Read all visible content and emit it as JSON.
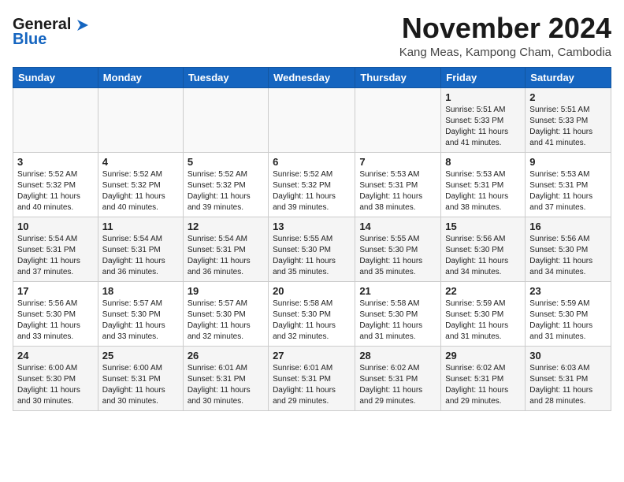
{
  "header": {
    "logo_general": "General",
    "logo_blue": "Blue",
    "month": "November 2024",
    "location": "Kang Meas, Kampong Cham, Cambodia"
  },
  "weekdays": [
    "Sunday",
    "Monday",
    "Tuesday",
    "Wednesday",
    "Thursday",
    "Friday",
    "Saturday"
  ],
  "weeks": [
    [
      {
        "day": "",
        "info": ""
      },
      {
        "day": "",
        "info": ""
      },
      {
        "day": "",
        "info": ""
      },
      {
        "day": "",
        "info": ""
      },
      {
        "day": "",
        "info": ""
      },
      {
        "day": "1",
        "info": "Sunrise: 5:51 AM\nSunset: 5:33 PM\nDaylight: 11 hours\nand 41 minutes."
      },
      {
        "day": "2",
        "info": "Sunrise: 5:51 AM\nSunset: 5:33 PM\nDaylight: 11 hours\nand 41 minutes."
      }
    ],
    [
      {
        "day": "3",
        "info": "Sunrise: 5:52 AM\nSunset: 5:32 PM\nDaylight: 11 hours\nand 40 minutes."
      },
      {
        "day": "4",
        "info": "Sunrise: 5:52 AM\nSunset: 5:32 PM\nDaylight: 11 hours\nand 40 minutes."
      },
      {
        "day": "5",
        "info": "Sunrise: 5:52 AM\nSunset: 5:32 PM\nDaylight: 11 hours\nand 39 minutes."
      },
      {
        "day": "6",
        "info": "Sunrise: 5:52 AM\nSunset: 5:32 PM\nDaylight: 11 hours\nand 39 minutes."
      },
      {
        "day": "7",
        "info": "Sunrise: 5:53 AM\nSunset: 5:31 PM\nDaylight: 11 hours\nand 38 minutes."
      },
      {
        "day": "8",
        "info": "Sunrise: 5:53 AM\nSunset: 5:31 PM\nDaylight: 11 hours\nand 38 minutes."
      },
      {
        "day": "9",
        "info": "Sunrise: 5:53 AM\nSunset: 5:31 PM\nDaylight: 11 hours\nand 37 minutes."
      }
    ],
    [
      {
        "day": "10",
        "info": "Sunrise: 5:54 AM\nSunset: 5:31 PM\nDaylight: 11 hours\nand 37 minutes."
      },
      {
        "day": "11",
        "info": "Sunrise: 5:54 AM\nSunset: 5:31 PM\nDaylight: 11 hours\nand 36 minutes."
      },
      {
        "day": "12",
        "info": "Sunrise: 5:54 AM\nSunset: 5:31 PM\nDaylight: 11 hours\nand 36 minutes."
      },
      {
        "day": "13",
        "info": "Sunrise: 5:55 AM\nSunset: 5:30 PM\nDaylight: 11 hours\nand 35 minutes."
      },
      {
        "day": "14",
        "info": "Sunrise: 5:55 AM\nSunset: 5:30 PM\nDaylight: 11 hours\nand 35 minutes."
      },
      {
        "day": "15",
        "info": "Sunrise: 5:56 AM\nSunset: 5:30 PM\nDaylight: 11 hours\nand 34 minutes."
      },
      {
        "day": "16",
        "info": "Sunrise: 5:56 AM\nSunset: 5:30 PM\nDaylight: 11 hours\nand 34 minutes."
      }
    ],
    [
      {
        "day": "17",
        "info": "Sunrise: 5:56 AM\nSunset: 5:30 PM\nDaylight: 11 hours\nand 33 minutes."
      },
      {
        "day": "18",
        "info": "Sunrise: 5:57 AM\nSunset: 5:30 PM\nDaylight: 11 hours\nand 33 minutes."
      },
      {
        "day": "19",
        "info": "Sunrise: 5:57 AM\nSunset: 5:30 PM\nDaylight: 11 hours\nand 32 minutes."
      },
      {
        "day": "20",
        "info": "Sunrise: 5:58 AM\nSunset: 5:30 PM\nDaylight: 11 hours\nand 32 minutes."
      },
      {
        "day": "21",
        "info": "Sunrise: 5:58 AM\nSunset: 5:30 PM\nDaylight: 11 hours\nand 31 minutes."
      },
      {
        "day": "22",
        "info": "Sunrise: 5:59 AM\nSunset: 5:30 PM\nDaylight: 11 hours\nand 31 minutes."
      },
      {
        "day": "23",
        "info": "Sunrise: 5:59 AM\nSunset: 5:30 PM\nDaylight: 11 hours\nand 31 minutes."
      }
    ],
    [
      {
        "day": "24",
        "info": "Sunrise: 6:00 AM\nSunset: 5:30 PM\nDaylight: 11 hours\nand 30 minutes."
      },
      {
        "day": "25",
        "info": "Sunrise: 6:00 AM\nSunset: 5:31 PM\nDaylight: 11 hours\nand 30 minutes."
      },
      {
        "day": "26",
        "info": "Sunrise: 6:01 AM\nSunset: 5:31 PM\nDaylight: 11 hours\nand 30 minutes."
      },
      {
        "day": "27",
        "info": "Sunrise: 6:01 AM\nSunset: 5:31 PM\nDaylight: 11 hours\nand 29 minutes."
      },
      {
        "day": "28",
        "info": "Sunrise: 6:02 AM\nSunset: 5:31 PM\nDaylight: 11 hours\nand 29 minutes."
      },
      {
        "day": "29",
        "info": "Sunrise: 6:02 AM\nSunset: 5:31 PM\nDaylight: 11 hours\nand 29 minutes."
      },
      {
        "day": "30",
        "info": "Sunrise: 6:03 AM\nSunset: 5:31 PM\nDaylight: 11 hours\nand 28 minutes."
      }
    ]
  ]
}
